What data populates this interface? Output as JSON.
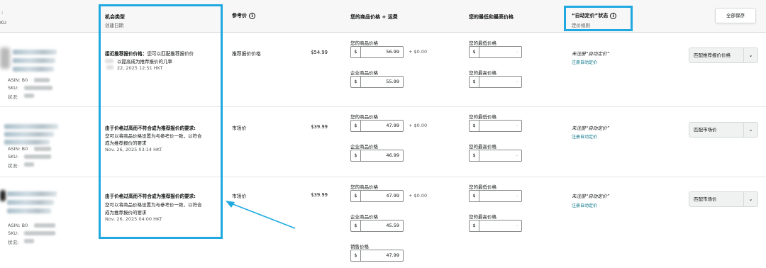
{
  "header": {
    "left_cut": "KU",
    "left_cut_top": ":",
    "opportunity_type": "机会类型",
    "created_date": "创建日期",
    "reference_price": "参考价",
    "your_price_shipping": "您的商品价格 + 运费",
    "min_max_price": "您的最低和最高价格",
    "auto_pricing_status": "“自动定价”状态",
    "pricing_rule": "定价规则",
    "save_all": "全部保存"
  },
  "labels": {
    "asin": "ASIN:",
    "sku": "SKU:",
    "status": "状况:",
    "your_price": "您的商品价格",
    "business_price": "企业商品价格",
    "sale_price": "销售价格",
    "min_price": "您的最低价格",
    "max_price": "您的最高价格",
    "currency": "$",
    "dash": "-",
    "not_registered": "未注册“自动定价”",
    "register_link": "注册自动定价"
  },
  "rows": [
    {
      "asin_prefix": "B0",
      "opp_title": "接近推荐报价价格：",
      "opp_line1_rest": "您可以匹配推荐报价价",
      "opp_line2": "以提高成为推荐报价的几率",
      "opp_date": "22, 2025 12:51 HKT",
      "ref_type": "推荐报价价格",
      "ref_price": "$54.99",
      "your_price": "56.99",
      "shipping": "+ $0.00",
      "business_price": "55.99",
      "action": "匹配推荐报价价格"
    },
    {
      "asin_prefix": "B0",
      "opp_title": "由于价格过高而不符合成为推荐报价的要求:",
      "opp_line1": "您可以将商品价格设置为与参考价一致，以符合",
      "opp_line2": "成为推荐报价的要求",
      "opp_date": "Nov. 26, 2025 03:14 HKT",
      "ref_type": "市场价",
      "ref_price": "$39.99",
      "your_price": "47.99",
      "shipping": "+ $0.00",
      "business_price": "46.99",
      "action": "匹配市场价"
    },
    {
      "asin_prefix": "B0",
      "opp_title": "由于价格过高而不符合成为推荐报价的要求:",
      "opp_line1": "您可以将商品价格设置为与参考价一致，以符合",
      "opp_line2": "成为推荐报价的要求",
      "opp_date": "Nov. 26, 2025 04:00 HKT",
      "ref_type": "市场价",
      "ref_price": "$39.99",
      "your_price": "47.99",
      "shipping": "+ $0.00",
      "business_price": "45.59",
      "sale_price": "47.99",
      "action": "匹配市场价"
    }
  ],
  "annotation": {
    "highlight_color": "#1fa9e0"
  }
}
